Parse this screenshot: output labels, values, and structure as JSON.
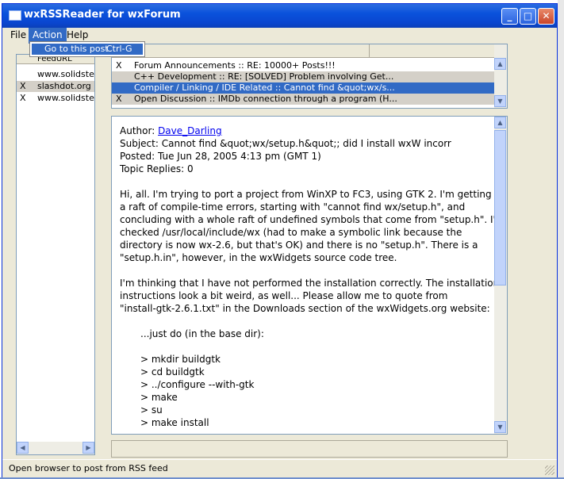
{
  "window": {
    "title": "wxRSSReader for wxForum",
    "minimize_glyph": "_",
    "maximize_glyph": "□",
    "close_glyph": "✕"
  },
  "menubar": {
    "file": "File",
    "action": "Action",
    "help": "Help"
  },
  "action_menu": {
    "item_label": "Go to this post",
    "item_shortcut": "Ctrl-G"
  },
  "feeds": {
    "header": "FeedURL",
    "rows": [
      {
        "mark": "",
        "name": "www.solidsteel.nl"
      },
      {
        "mark": "X",
        "name": "slashdot.org"
      },
      {
        "mark": "X",
        "name": "www.solidsteel.nl"
      }
    ],
    "scroll_left": "◀",
    "scroll_right": "▶"
  },
  "posts": {
    "rows": [
      {
        "mark": "X",
        "title": "Forum Announcements :: RE: 10000+ Posts!!!"
      },
      {
        "mark": "",
        "title": "C++ Development :: RE: [SOLVED] Problem involving Get..."
      },
      {
        "mark": "",
        "title": "Compiler / Linking / IDE Related :: Cannot find &quot;wx/s..."
      },
      {
        "mark": "X",
        "title": "Open Discussion :: IMDb connection through a program (H..."
      }
    ],
    "scroll_up": "▲",
    "scroll_down": "▼"
  },
  "post": {
    "author_label": "Author:",
    "author_name": "Dave_Darling",
    "subject": "Subject: Cannot find &quot;wx/setup.h&quot;; did I install wxW incorr",
    "posted": "Posted: Tue Jun 28, 2005 4:13 pm (GMT 1)",
    "replies": "Topic Replies: 0",
    "para1": [
      "Hi, all. I'm trying to port a project from WinXP to FC3, using GTK 2. I'm getting",
      "a raft of compile-time errors, starting with \"cannot find wx/setup.h\", and",
      "concluding with a whole raft of undefined symbols that come from \"setup.h\". I've",
      "checked /usr/local/include/wx (had to make a symbolic link because the",
      "directory is now wx-2.6, but that's OK) and there is no \"setup.h\". There is a",
      "\"setup.h.in\", however, in the wxWidgets source code tree."
    ],
    "para2": [
      "I'm thinking that I have not performed the installation correctly. The installation",
      "instructions look a bit weird, as well... Please allow me to quote from",
      "\"install-gtk-2.6.1.txt\" in the Downloads section of the wxWidgets.org website:"
    ],
    "quote_intro": "...just do (in the base dir):",
    "commands": [
      "> mkdir buildgtk",
      "> cd buildgtk",
      "> ../configure --with-gtk",
      "> make",
      "> su",
      "> make install"
    ]
  },
  "statusbar": {
    "text": "Open browser to post from RSS feed"
  }
}
